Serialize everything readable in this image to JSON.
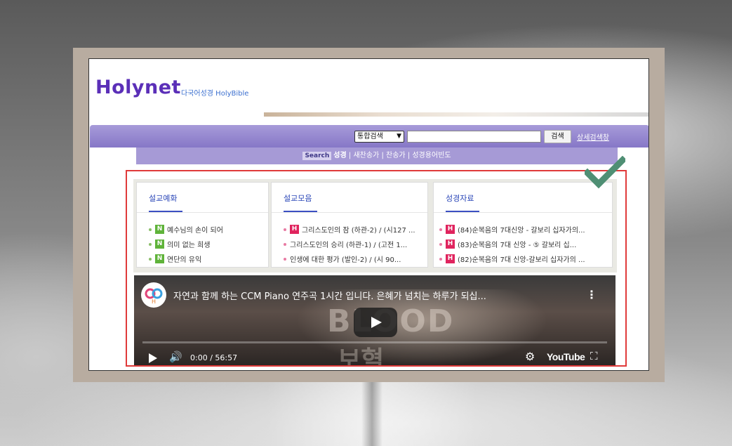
{
  "site": {
    "logo": "Holynet",
    "subtitle": "다국어성경 HolyBible"
  },
  "search": {
    "select_value": "통합검색",
    "input_value": "",
    "button_label": "검색",
    "advanced_label": "상세검색창"
  },
  "subnav": {
    "tag": "Search",
    "items": [
      "성경",
      "새찬송가",
      "찬송가",
      "성경용어빈도"
    ]
  },
  "panels": [
    {
      "title": "설교예화",
      "items": [
        {
          "badge": "N",
          "text": "예수님의 손이 되어"
        },
        {
          "badge": "N",
          "text": "의미 없는 희생"
        },
        {
          "badge": "N",
          "text": "연단의 유익"
        }
      ]
    },
    {
      "title": "설교모음",
      "items": [
        {
          "badge": "H",
          "text": "그리스도인의 잠 (하관-2) / (시127 ..."
        },
        {
          "badge": "",
          "text": "그리스도인의 승리 (하관-1) / (고전 1..."
        },
        {
          "badge": "",
          "text": "인생에 대한 평가 (발인-2) / (시 90..."
        }
      ]
    },
    {
      "title": "성경자료",
      "items": [
        {
          "badge": "H",
          "text": "(84)순복음의 7대신앙 - 갈보리 십자가의..."
        },
        {
          "badge": "H",
          "text": "(83)순복음의 7대 신앙 - ⑤ 갈보리 십..."
        },
        {
          "badge": "H",
          "text": "(82)순복음의 7대 신앙-갈보리 십자가의 ..."
        }
      ]
    }
  ],
  "video": {
    "title": "자연과 함께 하는 CCM Piano 연주곡 1시간 입니다. 은혜가 넘치는 하루가 되십...",
    "time": "0:00 / 56:57",
    "brand": "YouTube",
    "overlay_text": "BLOOD",
    "overlay_text2": "보혈"
  },
  "colors": {
    "accent": "#5b2fb8",
    "searchbar": "#8677c7",
    "highlight": "#e03a3a",
    "check": "#4f8f74"
  },
  "icons": [
    "play-icon",
    "volume-icon",
    "settings-icon",
    "fullscreen-icon",
    "more-icon",
    "check-icon"
  ]
}
